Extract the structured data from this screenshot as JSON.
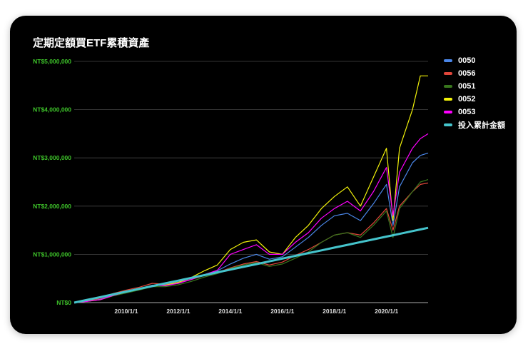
{
  "chart_data": {
    "type": "line",
    "title": "定期定額買ETF累積資產",
    "xlabel": "",
    "ylabel": "",
    "ylim": [
      0,
      5000000
    ],
    "xlim": [
      2008.0,
      2021.6
    ],
    "yticks": [
      "NT$0",
      "NT$1,000,000",
      "NT$2,000,000",
      "NT$3,000,000",
      "NT$4,000,000",
      "NT$5,000,000"
    ],
    "ytick_values": [
      0,
      1000000,
      2000000,
      3000000,
      4000000,
      5000000
    ],
    "xticks": [
      "2010/1/1",
      "2012/1/1",
      "2014/1/1",
      "2016/1/1",
      "2018/1/1",
      "2020/1/1"
    ],
    "xtick_values": [
      2010,
      2012,
      2014,
      2016,
      2018,
      2020
    ],
    "grid": true,
    "legend_position": "right",
    "x": [
      2008,
      2008.5,
      2009,
      2009.5,
      2010,
      2010.5,
      2011,
      2011.5,
      2012,
      2012.5,
      2013,
      2013.5,
      2014,
      2014.5,
      2015,
      2015.5,
      2016,
      2016.5,
      2017,
      2017.5,
      2018,
      2018.5,
      2019,
      2019.5,
      2020,
      2020.25,
      2020.5,
      2021,
      2021.3,
      2021.6
    ],
    "series": [
      {
        "name": "0050",
        "color": "#4a86e8",
        "values": [
          0,
          30000,
          70000,
          160000,
          220000,
          280000,
          360000,
          370000,
          400000,
          480000,
          580000,
          660000,
          800000,
          920000,
          1000000,
          900000,
          950000,
          1150000,
          1350000,
          1600000,
          1800000,
          1850000,
          1700000,
          2050000,
          2450000,
          1600000,
          2400000,
          2900000,
          3050000,
          3100000
        ]
      },
      {
        "name": "0056",
        "color": "#e0463a",
        "values": [
          0,
          40000,
          90000,
          190000,
          260000,
          320000,
          400000,
          380000,
          420000,
          480000,
          560000,
          620000,
          720000,
          800000,
          850000,
          780000,
          840000,
          980000,
          1100000,
          1250000,
          1400000,
          1450000,
          1400000,
          1650000,
          1950000,
          1500000,
          2000000,
          2300000,
          2450000,
          2480000
        ]
      },
      {
        "name": "0051",
        "color": "#38761d",
        "values": [
          0,
          30000,
          60000,
          140000,
          200000,
          260000,
          330000,
          330000,
          370000,
          440000,
          530000,
          600000,
          710000,
          780000,
          830000,
          750000,
          800000,
          920000,
          1050000,
          1250000,
          1400000,
          1450000,
          1350000,
          1600000,
          1900000,
          1350000,
          1950000,
          2300000,
          2500000,
          2550000
        ]
      },
      {
        "name": "0052",
        "color": "#f2f20a",
        "values": [
          0,
          30000,
          60000,
          150000,
          220000,
          280000,
          360000,
          360000,
          420000,
          520000,
          660000,
          780000,
          1100000,
          1250000,
          1300000,
          1050000,
          1000000,
          1350000,
          1600000,
          1950000,
          2200000,
          2400000,
          2000000,
          2600000,
          3200000,
          1700000,
          3200000,
          4000000,
          4700000,
          4700000
        ]
      },
      {
        "name": "0053",
        "color": "#ff00ff",
        "values": [
          0,
          25000,
          60000,
          150000,
          220000,
          280000,
          360000,
          350000,
          400000,
          480000,
          580000,
          670000,
          1000000,
          1100000,
          1200000,
          1000000,
          1000000,
          1250000,
          1450000,
          1750000,
          1950000,
          2100000,
          1900000,
          2300000,
          2800000,
          1800000,
          2700000,
          3200000,
          3400000,
          3500000
        ]
      },
      {
        "name": "投入累計金額",
        "color": "#45c4cc",
        "values": [
          0,
          57000,
          114000,
          171000,
          228000,
          285000,
          342000,
          399000,
          456000,
          513000,
          570000,
          627000,
          684000,
          741000,
          798000,
          855000,
          912000,
          969000,
          1026000,
          1083000,
          1140000,
          1197000,
          1254000,
          1311000,
          1368000,
          1396000,
          1425000,
          1482000,
          1516000,
          1550000
        ]
      }
    ]
  }
}
